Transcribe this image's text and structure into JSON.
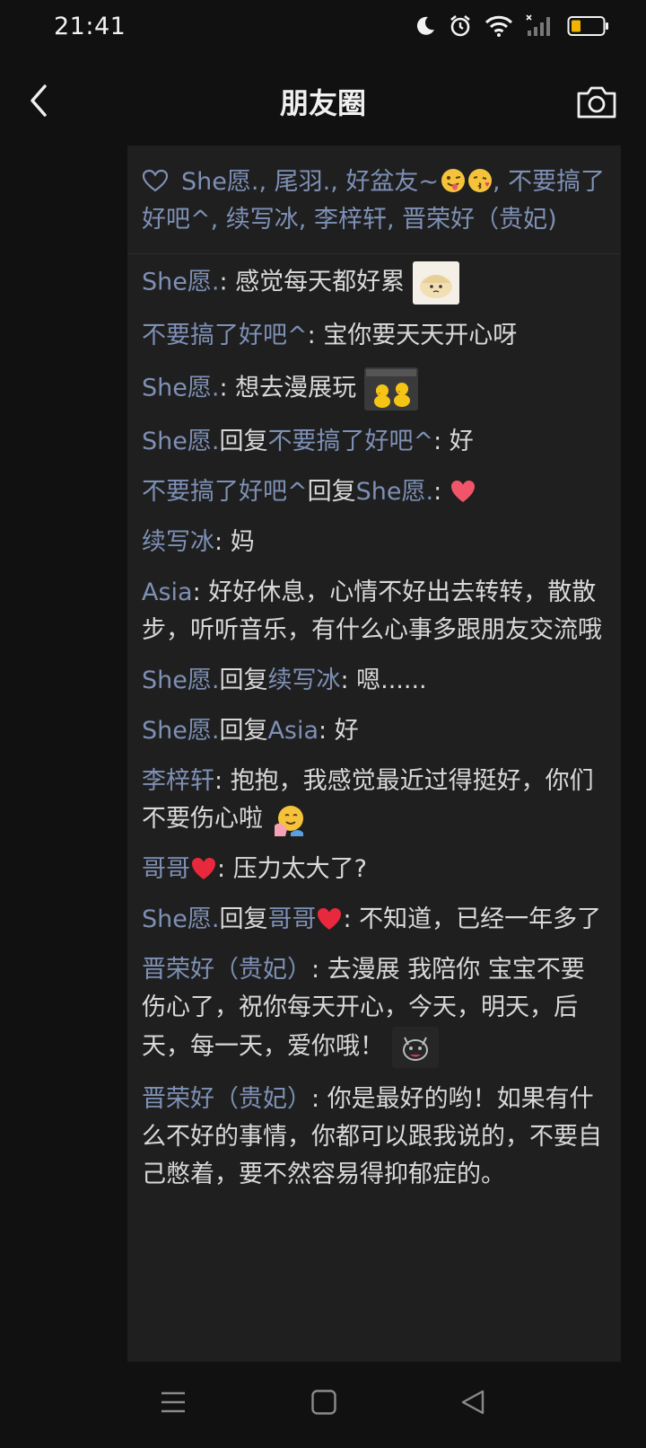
{
  "status_bar": {
    "time": "21:41",
    "icons": [
      "moon-icon",
      "alarm-icon",
      "wifi-icon",
      "signal-icon",
      "battery-icon"
    ],
    "battery_color": "#f0b400"
  },
  "header": {
    "title": "朋友圈",
    "back_icon": "chevron-left-icon",
    "camera_icon": "camera-icon"
  },
  "likes": {
    "names_part1": "She愿., 尾羽., 好盆友~",
    "names_part2": ", 不要搞了好吧^, 续写冰, 李梓轩, 晋荣好（贵妃)"
  },
  "comments": [
    {
      "author": "She愿.",
      "sep": ": ",
      "text": "感觉每天都好累",
      "sticker": "dumpling-sticker"
    },
    {
      "author": "不要搞了好吧^",
      "sep": ": ",
      "text": "宝你要天天开心呀"
    },
    {
      "author": "She愿.",
      "sep": ": ",
      "text": "想去漫展玩",
      "sticker": "duck-meme-sticker"
    },
    {
      "author": "She愿.",
      "reply_word": "回复",
      "reply_to": "不要搞了好吧^",
      "sep": ": ",
      "text": "好"
    },
    {
      "author": "不要搞了好吧^",
      "reply_word": "回复",
      "reply_to": "She愿.",
      "sep": ": ",
      "text": "",
      "emoji": "heart-emoji"
    },
    {
      "author": "续写冰",
      "sep": ": ",
      "text": "妈"
    },
    {
      "author": "Asia",
      "sep": ": ",
      "text": "好好休息，心情不好出去转转，散散步，听听音乐，有什么心事多跟朋友交流哦"
    },
    {
      "author": "She愿.",
      "reply_word": "回复",
      "reply_to": "续写冰",
      "sep": ": ",
      "text": "嗯......"
    },
    {
      "author": "She愿.",
      "reply_word": "回复",
      "reply_to": "Asia",
      "sep": ": ",
      "text": "好"
    },
    {
      "author": "李梓轩",
      "sep": ": ",
      "text": "抱抱，我感觉最近过得挺好，你们不要伤心啦",
      "emoji": "hug-emoji"
    },
    {
      "author": "哥哥",
      "author_emoji": "heart-emoji",
      "sep": ": ",
      "text": "压力太大了?"
    },
    {
      "author": "She愿.",
      "reply_word": "回复",
      "reply_to": "哥哥",
      "reply_emoji": "heart-emoji",
      "sep": ": ",
      "text": "不知道，已经一年多了"
    },
    {
      "author": "晋荣好（贵妃）",
      "sep": ": ",
      "text": "去漫展  我陪你  宝宝不要伤心了，祝你每天开心，今天，明天，后天，每一天，爱你哦！",
      "sticker": "cat-sticker"
    },
    {
      "author": "晋荣好（贵妃）",
      "sep": ": ",
      "text": "你是最好的哟！如果有什么不好的事情，你都可以跟我说的，不要自己憋着，要不然容易得抑郁症的。"
    }
  ],
  "nav": {
    "menu_icon": "menu-icon",
    "home_icon": "home-icon",
    "back_icon": "back-triangle-icon"
  },
  "colors": {
    "background": "#111111",
    "panel": "#1f1f1f",
    "name_link": "#7e90b5",
    "text": "#d9d9d9"
  }
}
